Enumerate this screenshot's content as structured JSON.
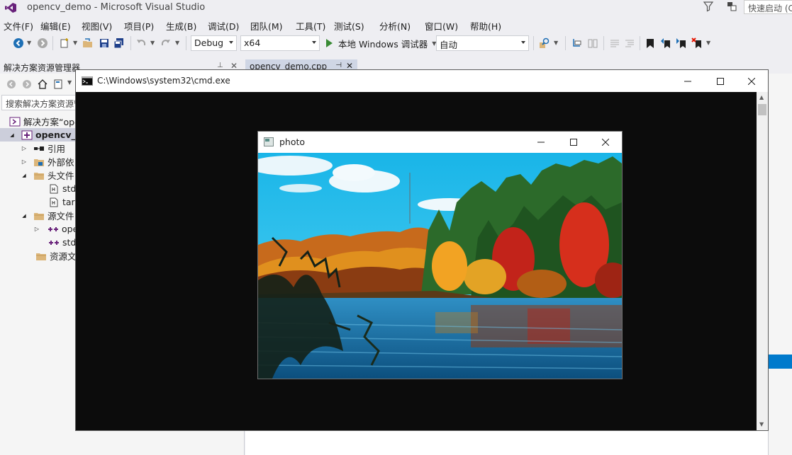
{
  "vs": {
    "title": "opencv_demo - Microsoft Visual Studio",
    "quick_launch": "快速启动 (C"
  },
  "menu": [
    "文件(F)",
    "编辑(E)",
    "视图(V)",
    "项目(P)",
    "生成(B)",
    "调试(D)",
    "团队(M)",
    "工具(T)",
    "测试(S)",
    "分析(N)",
    "窗口(W)",
    "帮助(H)"
  ],
  "toolbar": {
    "config": "Debug",
    "platform": "x64",
    "debugger": "本地 Windows 调试器",
    "auto": "自动"
  },
  "solution_explorer": {
    "title": "解决方案资源管理器",
    "search_placeholder": "搜索解决方案资源管",
    "tree": [
      {
        "label": "解决方案“ope",
        "icon": "solution-icon",
        "arrow": ""
      },
      {
        "label": "opencv_d",
        "icon": "project-icon",
        "arrow": "▲",
        "selected": true
      },
      {
        "label": "引用",
        "icon": "references-icon",
        "arrow": "▷"
      },
      {
        "label": "外部依",
        "icon": "external-deps-icon",
        "arrow": "▷"
      },
      {
        "label": "头文件",
        "icon": "folder-icon",
        "arrow": "◢"
      },
      {
        "label": "std",
        "icon": "header-file-icon",
        "arrow": ""
      },
      {
        "label": "targ",
        "icon": "header-file-icon",
        "arrow": ""
      },
      {
        "label": "源文件",
        "icon": "folder-icon",
        "arrow": "◢"
      },
      {
        "label": "ope",
        "icon": "cpp-file-icon",
        "arrow": "▷"
      },
      {
        "label": "std",
        "icon": "cpp-file-icon",
        "arrow": ""
      },
      {
        "label": "资源文",
        "icon": "folder-icon",
        "arrow": ""
      }
    ]
  },
  "document_tab": {
    "label": "opencv_demo.cpp"
  },
  "cmd_window": {
    "title": "C:\\Windows\\system32\\cmd.exe"
  },
  "photo_window": {
    "title": "photo"
  },
  "colors": {
    "vs_bg": "#eeeef2",
    "accent": "#007acc",
    "play": "#388a34",
    "console_bg": "#0c0c0c"
  }
}
